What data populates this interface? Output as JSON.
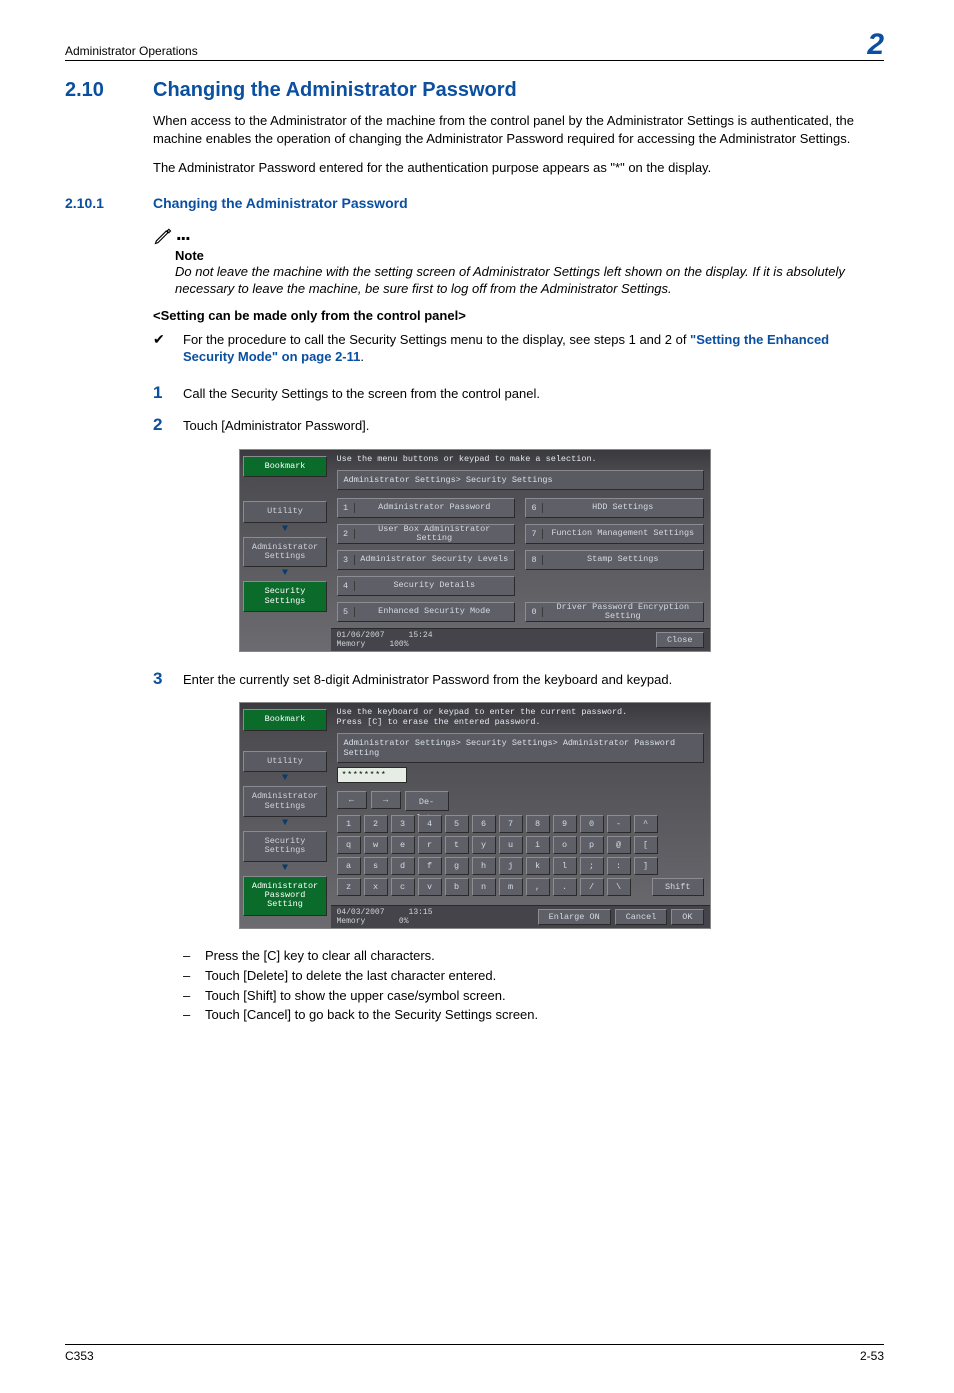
{
  "header": {
    "running": "Administrator Operations",
    "chapter": "2"
  },
  "section": {
    "num": "2.10",
    "title": "Changing the Administrator Password"
  },
  "intro": {
    "p1": "When access to the Administrator of the machine from the control panel by the Administrator Settings is authenticated, the machine enables the operation of changing the Administrator Password required for accessing the Administrator Settings.",
    "p2": "The Administrator Password entered for the authentication purpose appears as \"*\" on the display."
  },
  "subsection": {
    "num": "2.10.1",
    "title": "Changing the Administrator Password"
  },
  "note": {
    "label": "Note",
    "body": "Do not leave the machine with the setting screen of Administrator Settings left shown on the display. If it is absolutely necessary to leave the machine, be sure first to log off from the Administrator Settings."
  },
  "setting_head": "<Setting can be made only from the control panel>",
  "proc_link": {
    "pre": "For the procedure to call the Security Settings menu to the display, see steps 1 and 2 of ",
    "link": "\"Setting the Enhanced Security Mode\" on page 2-11",
    "post": "."
  },
  "steps": {
    "s1": "Call the Security Settings to the screen from the control panel.",
    "s2": "Touch [Administrator Password].",
    "s3": "Enter the currently set 8-digit Administrator Password from the keyboard and keypad."
  },
  "dashes": {
    "d1": "Press the [C] key to clear all characters.",
    "d2": "Touch [Delete] to delete the last character entered.",
    "d3": "Touch [Shift] to show the upper case/symbol screen.",
    "d4": "Touch [Cancel] to go back to the Security Settings screen."
  },
  "footer": {
    "left": "C353",
    "right": "2-53"
  },
  "shot1": {
    "top": "Use the menu buttons or keypad to make a selection.",
    "breadcrumb": "Administrator Settings> Security Settings",
    "side": {
      "bookmark": "Bookmark",
      "utility": "Utility",
      "admin": "Administrator Settings",
      "sec": "Security Settings"
    },
    "items": [
      {
        "n": "1",
        "l": "Administrator Password"
      },
      {
        "n": "2",
        "l": "User Box Administrator Setting"
      },
      {
        "n": "3",
        "l": "Administrator Security Levels"
      },
      {
        "n": "4",
        "l": "Security Details"
      },
      {
        "n": "5",
        "l": "Enhanced Security Mode"
      },
      {
        "n": "6",
        "l": "HDD Settings"
      },
      {
        "n": "7",
        "l": "Function Management Settings"
      },
      {
        "n": "8",
        "l": "Stamp Settings"
      },
      {
        "n": "",
        "l": ""
      },
      {
        "n": "0",
        "l": "Driver Password Encryption Setting"
      }
    ],
    "status_date": "01/06/2007",
    "status_time": "15:24",
    "status_mem": "Memory",
    "status_pct": "100%",
    "close": "Close"
  },
  "shot2": {
    "top": "Use the keyboard or keypad to enter the current password.\nPress [C] to erase the entered password.",
    "breadcrumb": "Administrator Settings> Security Settings> Administrator Password Setting",
    "side": {
      "bookmark": "Bookmark",
      "utility": "Utility",
      "admin": "Administrator Settings",
      "sec": "Security Settings",
      "pwd": "Administrator Password Setting"
    },
    "password_mask": "********",
    "delete": "De-\nlete",
    "row1": [
      "1",
      "2",
      "3",
      "4",
      "5",
      "6",
      "7",
      "8",
      "9",
      "0",
      "-",
      "^"
    ],
    "row2": [
      "q",
      "w",
      "e",
      "r",
      "t",
      "y",
      "u",
      "i",
      "o",
      "p",
      "@",
      "["
    ],
    "row3": [
      "a",
      "s",
      "d",
      "f",
      "g",
      "h",
      "j",
      "k",
      "l",
      ";",
      ":",
      "]"
    ],
    "row4": [
      "z",
      "x",
      "c",
      "v",
      "b",
      "n",
      "m",
      ",",
      ".",
      "/",
      "\\"
    ],
    "shift": "Shift",
    "status_date": "04/03/2007",
    "status_time": "13:15",
    "status_mem": "Memory",
    "status_pct": "0%",
    "enlarge": "Enlarge ON",
    "cancel": "Cancel",
    "ok": "OK"
  }
}
